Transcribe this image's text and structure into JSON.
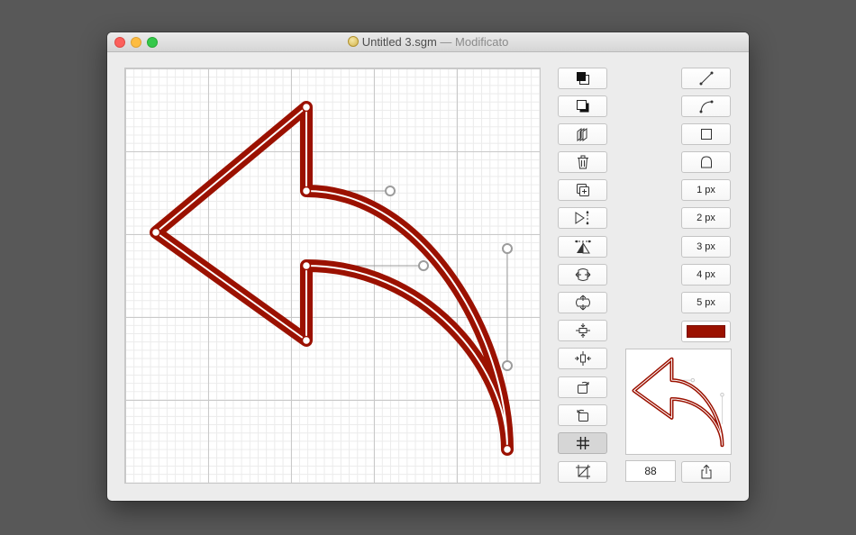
{
  "window": {
    "title": "Untitled 3.sgm",
    "separator": "—",
    "status": "Modificato"
  },
  "colors": {
    "stroke": "#9b1100",
    "stroke_fill": "#ffffff",
    "grid_major": "#c9c9c9",
    "grid_minor": "#ebebeb"
  },
  "toolbar_left": [
    {
      "name": "bring-to-front",
      "icon": "bring-to-front-icon"
    },
    {
      "name": "send-to-back",
      "icon": "send-to-back-icon"
    },
    {
      "name": "combine-paths",
      "icon": "stacked-paths-icon"
    },
    {
      "name": "delete",
      "icon": "trash-icon"
    },
    {
      "name": "duplicate",
      "icon": "duplicate-plus-icon"
    },
    {
      "name": "flip-horizontal",
      "icon": "flip-horizontal-icon"
    },
    {
      "name": "flip-vertical",
      "icon": "flip-vertical-icon"
    },
    {
      "name": "scale-horizontal",
      "icon": "resize-horizontal-icon"
    },
    {
      "name": "scale-vertical",
      "icon": "resize-vertical-icon"
    },
    {
      "name": "center-vertical",
      "icon": "center-vertical-icon"
    },
    {
      "name": "center-horizontal",
      "icon": "center-horizontal-icon"
    },
    {
      "name": "rotate-right",
      "icon": "rotate-right-icon"
    },
    {
      "name": "rotate-left",
      "icon": "rotate-left-icon"
    },
    {
      "name": "toggle-grid",
      "icon": "grid-icon",
      "active": true
    },
    {
      "name": "crop-canvas",
      "icon": "crop-icon"
    }
  ],
  "toolbar_right": {
    "line_tool": "line-tool-icon",
    "curve_tool": "curve-tool-icon",
    "rect_tool": "rectangle-icon",
    "arch_tool": "arch-icon",
    "stroke_widths": [
      "1 px",
      "2 px",
      "3 px",
      "4 px",
      "5 px"
    ]
  },
  "preview": {
    "size_value": "88",
    "share_icon": "share-icon"
  }
}
